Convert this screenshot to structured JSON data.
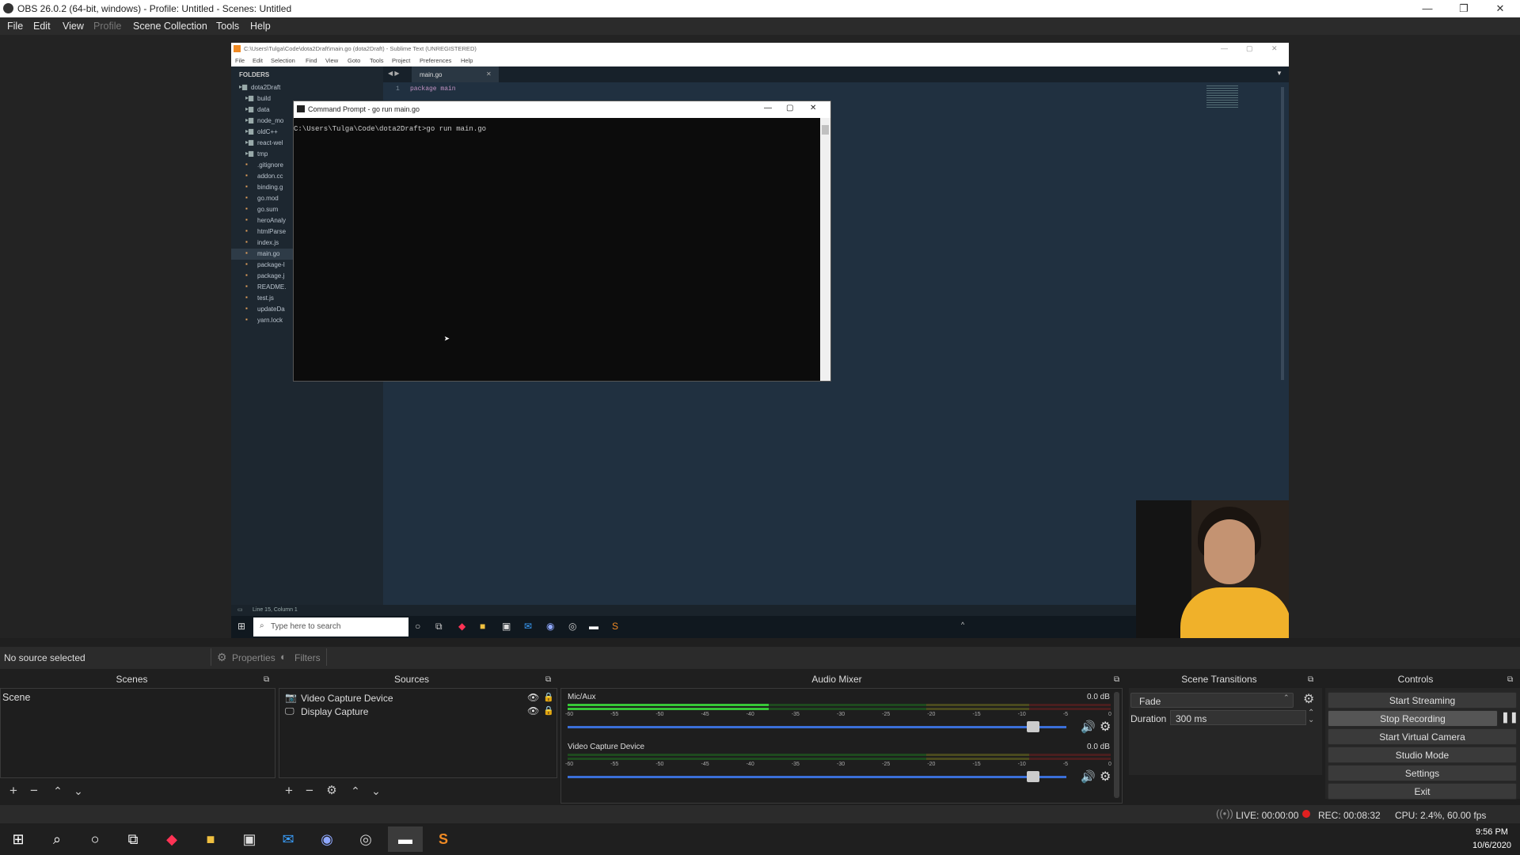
{
  "window": {
    "title": "OBS 26.0.2 (64-bit, windows) - Profile: Untitled - Scenes: Untitled",
    "minimize": "—",
    "maximize": "❐",
    "close": "✕"
  },
  "menu": [
    "File",
    "Edit",
    "View",
    "Profile",
    "Scene Collection",
    "Tools",
    "Help"
  ],
  "sublime": {
    "title": "C:\\Users\\Tulga\\Code\\dota2Draft\\main.go (dota2Draft) - Sublime Text (UNREGISTERED)",
    "menu": [
      "File",
      "Edit",
      "Selection",
      "Find",
      "View",
      "Goto",
      "Tools",
      "Project",
      "Preferences",
      "Help"
    ],
    "folders_label": "FOLDERS",
    "tree": [
      "dota2Draft",
      "build",
      "data",
      "node_mo",
      "oldC++",
      "react-wel",
      "tmp",
      ".gitignore",
      "addon.cc",
      "binding.g",
      "go.mod",
      "go.sum",
      "heroAnaly",
      "htmlParse",
      "index.js",
      "main.go",
      "package-l",
      "package.j",
      "README.",
      "test.js",
      "updateDa",
      "yarn.lock"
    ],
    "tab": "main.go",
    "code_line_no": "1",
    "code": "package main",
    "status": "Line 15, Column 1"
  },
  "inner_taskbar": {
    "search_placeholder": "Type here to search"
  },
  "cmd": {
    "title": "Command Prompt - go  run main.go",
    "line": "C:\\Users\\Tulga\\Code\\dota2Draft>go run main.go"
  },
  "source_bar": {
    "status": "No source selected",
    "properties": "Properties",
    "filters": "Filters"
  },
  "scenes": {
    "header": "Scenes",
    "items": [
      "Scene"
    ]
  },
  "sources": {
    "header": "Sources",
    "items": [
      "Video Capture Device",
      "Display Capture"
    ]
  },
  "mixer": {
    "header": "Audio Mixer",
    "channels": [
      {
        "name": "Mic/Aux",
        "db": "0.0 dB",
        "level": 0.37,
        "volume": 0.92
      },
      {
        "name": "Video Capture Device",
        "db": "0.0 dB",
        "level": 0,
        "volume": 0.92
      }
    ],
    "scale": [
      "-60",
      "-55",
      "-50",
      "-45",
      "-40",
      "-35",
      "-30",
      "-25",
      "-20",
      "-15",
      "-10",
      "-5",
      "0"
    ]
  },
  "transitions": {
    "header": "Scene Transitions",
    "selected": "Fade",
    "duration_label": "Duration",
    "duration": "300 ms"
  },
  "controls": {
    "header": "Controls",
    "buttons": [
      "Start Streaming",
      "Stop Recording",
      "Start Virtual Camera",
      "Studio Mode",
      "Settings",
      "Exit"
    ]
  },
  "statusbar": {
    "live": "LIVE: 00:00:00",
    "rec": "REC: 00:08:32",
    "cpu": "CPU: 2.4%, 60.00 fps"
  },
  "taskbar": {
    "time": "9:56 PM",
    "date": "10/6/2020"
  },
  "colors": {
    "accent": "#3a6fd8",
    "meter_green": "#37c837",
    "meter_yellow": "#c8c837",
    "meter_red": "#c83737",
    "rec_dot": "#e02020"
  }
}
